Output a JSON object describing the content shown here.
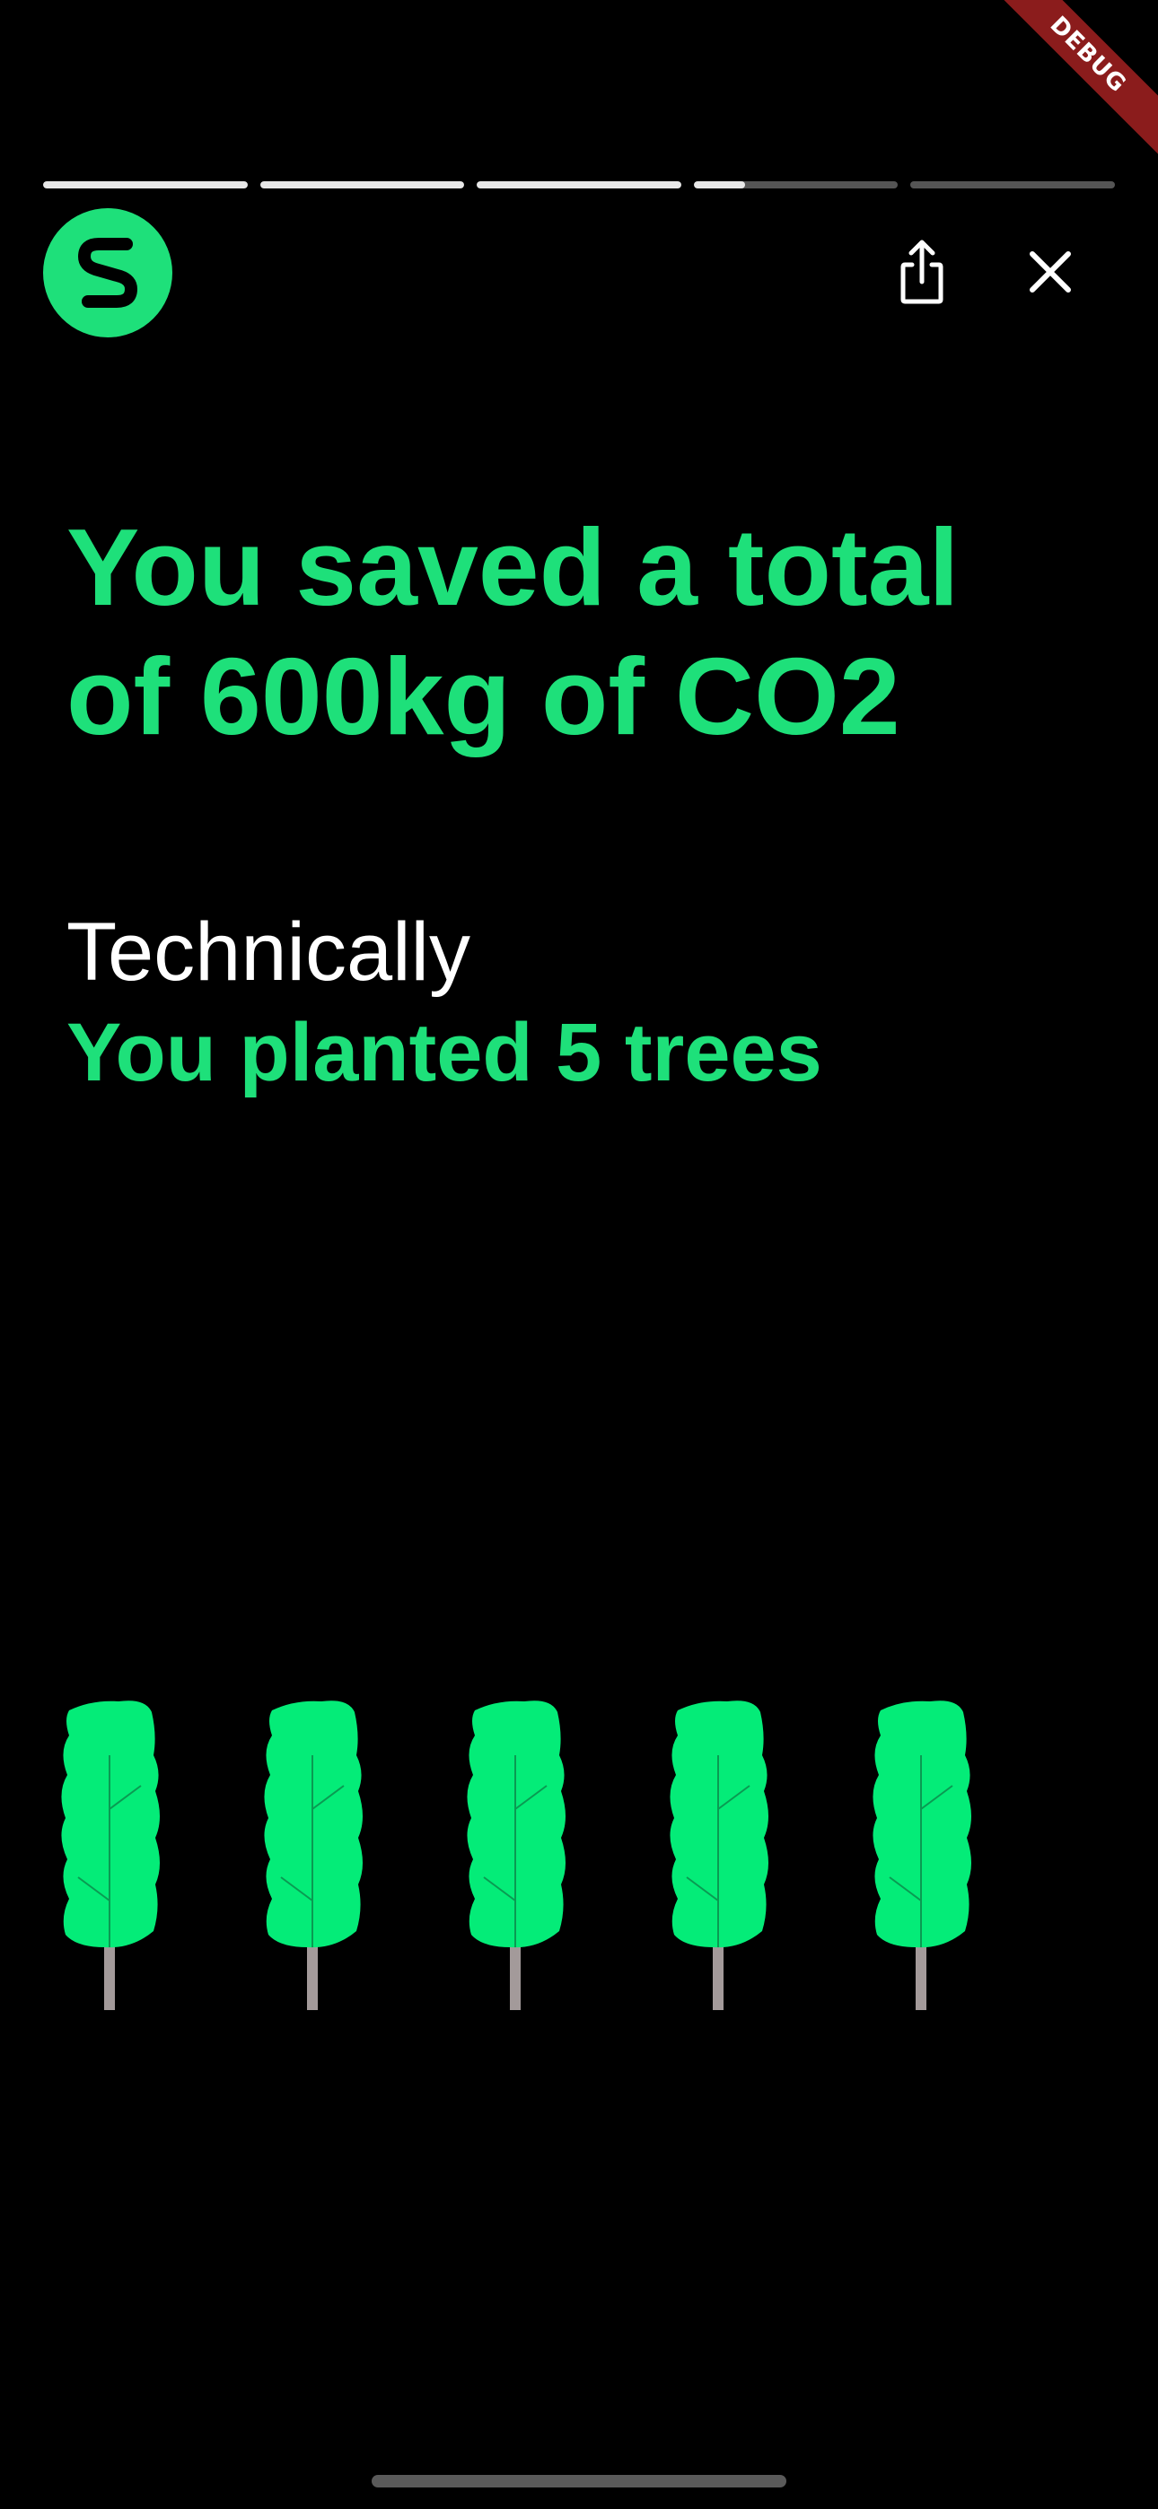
{
  "debug_banner": {
    "label": "DEBUG",
    "color": "#8b1c1c"
  },
  "progress": {
    "segments": [
      1,
      1,
      1,
      0.25,
      0
    ],
    "active_color": "#e8e8e8",
    "inactive_color": "#555555"
  },
  "header": {
    "logo": {
      "icon": "s-logo-icon",
      "color": "#1ee07a"
    },
    "share": {
      "icon": "share-icon"
    },
    "close": {
      "icon": "close-icon"
    }
  },
  "main": {
    "headline_line1": "You saved a total",
    "headline_line2": "of 600kg of CO2",
    "subtitle": "Technically",
    "highlight": "You planted 5 trees"
  },
  "trees": {
    "count": 5,
    "leaf_color": "#04ec78",
    "trunk_color": "#a39a9a"
  },
  "colors": {
    "accent": "#1ee07a",
    "background": "#000000"
  }
}
